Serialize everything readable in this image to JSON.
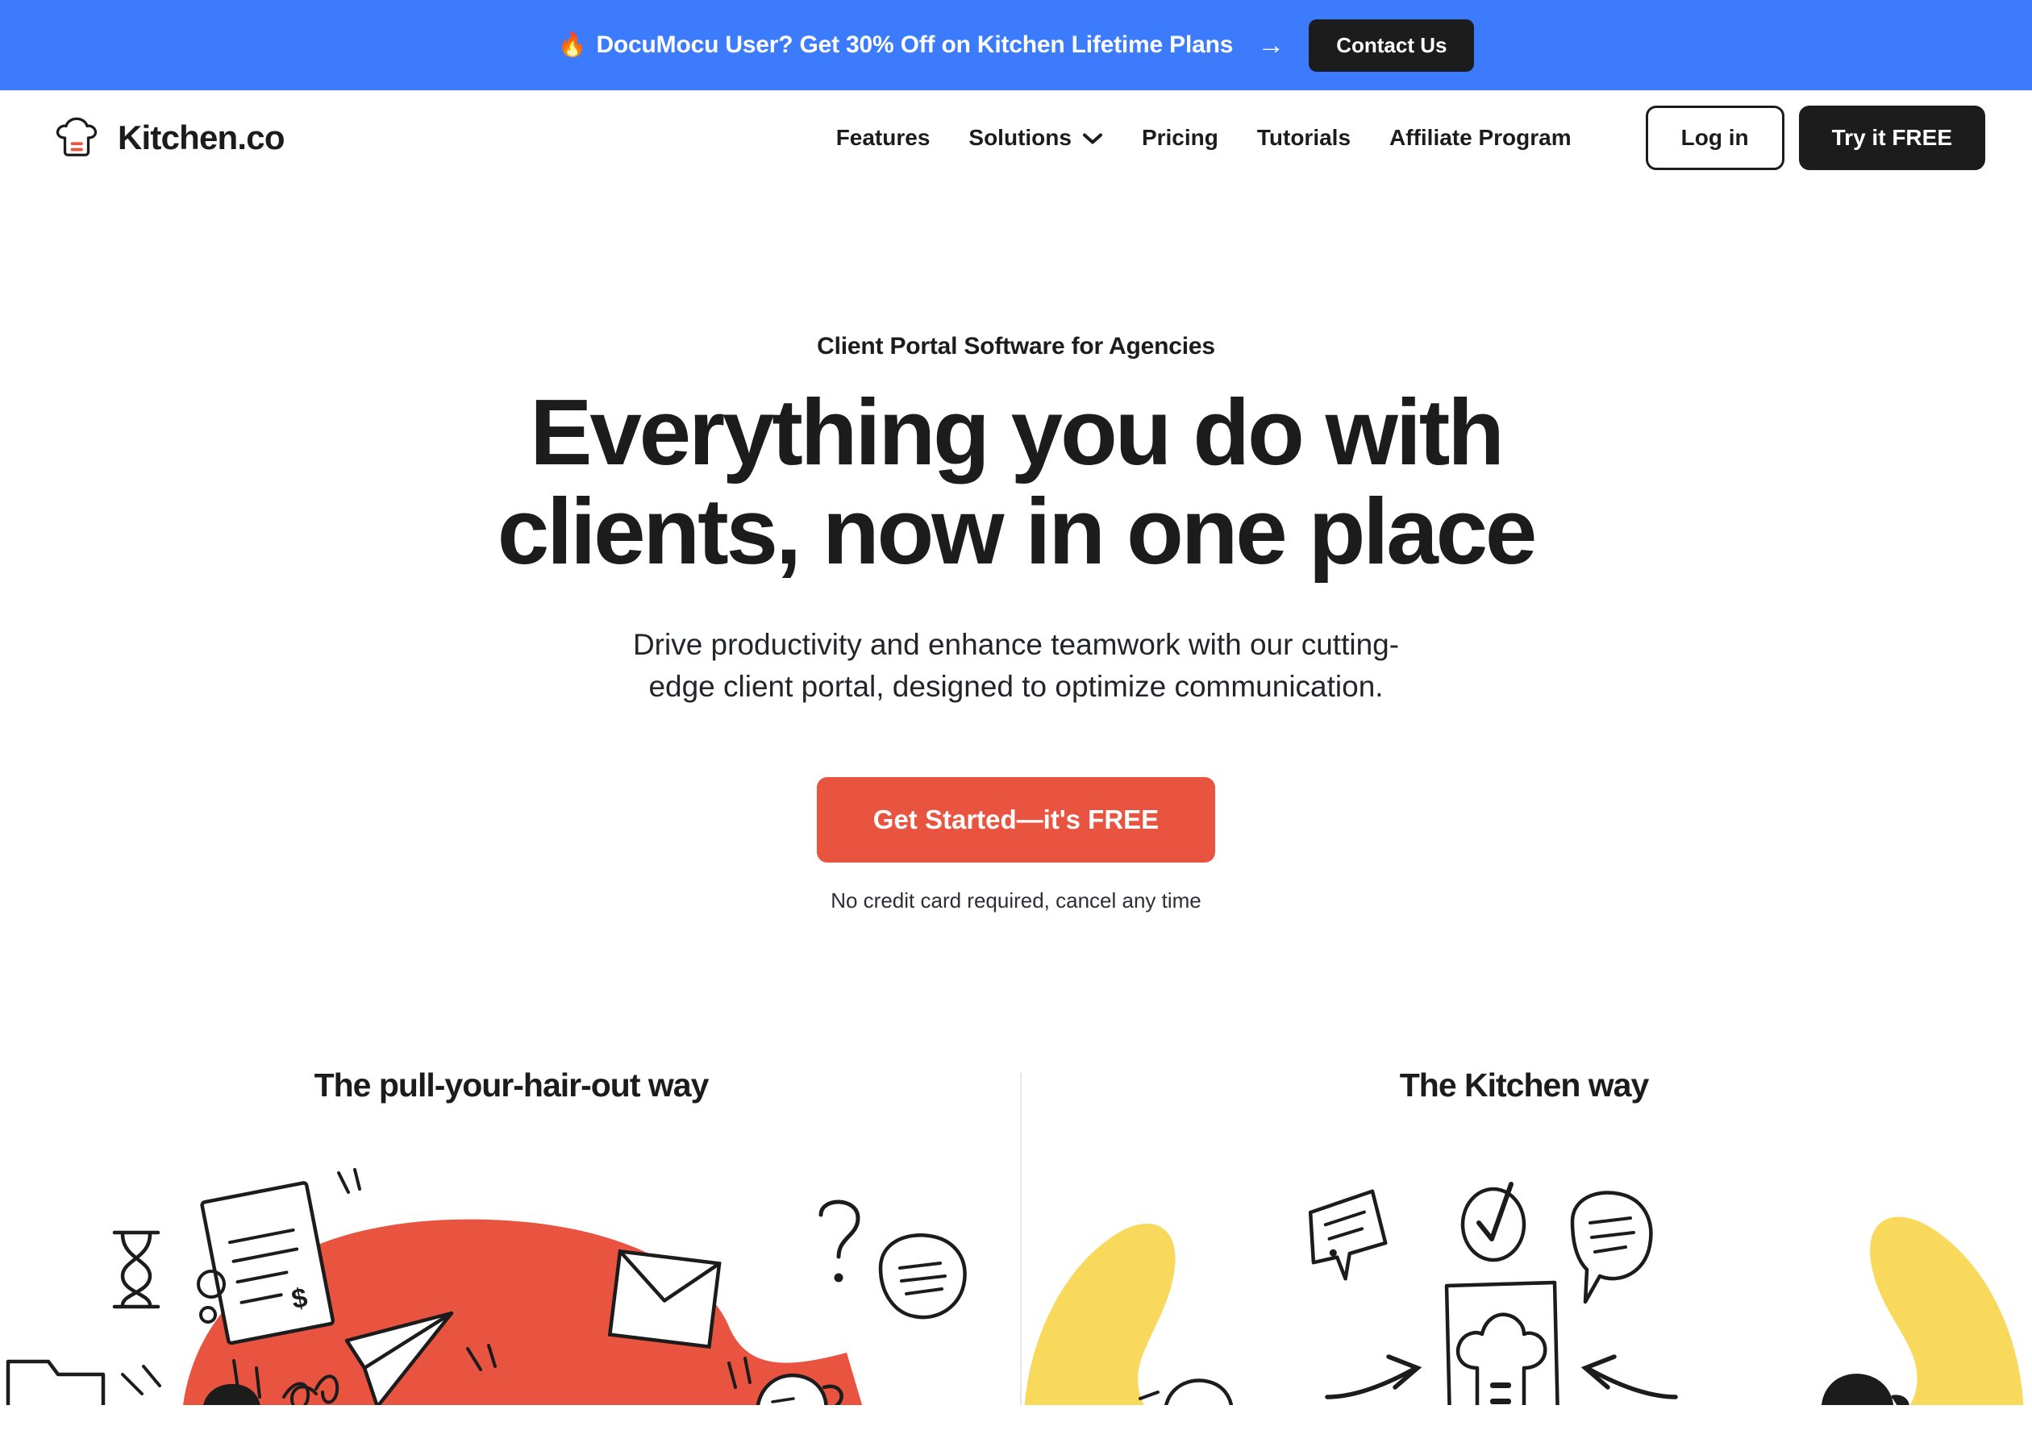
{
  "promo": {
    "fire_icon": "🔥",
    "text": "DocuMocu User? Get 30% Off on Kitchen Lifetime Plans",
    "arrow": "→",
    "cta_label": "Contact Us",
    "background_color": "#3b7bfc"
  },
  "header": {
    "brand_name": "Kitchen.co",
    "nav": [
      {
        "label": "Features",
        "has_dropdown": false
      },
      {
        "label": "Solutions",
        "has_dropdown": true
      },
      {
        "label": "Pricing",
        "has_dropdown": false
      },
      {
        "label": "Tutorials",
        "has_dropdown": false
      },
      {
        "label": "Affiliate Program",
        "has_dropdown": false
      }
    ],
    "login_label": "Log in",
    "try_label": "Try it FREE"
  },
  "hero": {
    "eyebrow": "Client Portal Software for Agencies",
    "title_line1": "Everything you do with",
    "title_line2": "clients, now in one place",
    "subtitle_line1": "Drive productivity and enhance teamwork with our cutting-",
    "subtitle_line2": "edge client portal, designed to optimize communication.",
    "cta_label": "Get Started—it's FREE",
    "note": "No credit card required, cancel any time",
    "cta_color": "#e8543f"
  },
  "comparison": {
    "left_heading": "The pull-your-hair-out way",
    "right_heading": "The Kitchen way",
    "left_blob_color": "#e8543f",
    "right_blob_color": "#f8d95c"
  }
}
